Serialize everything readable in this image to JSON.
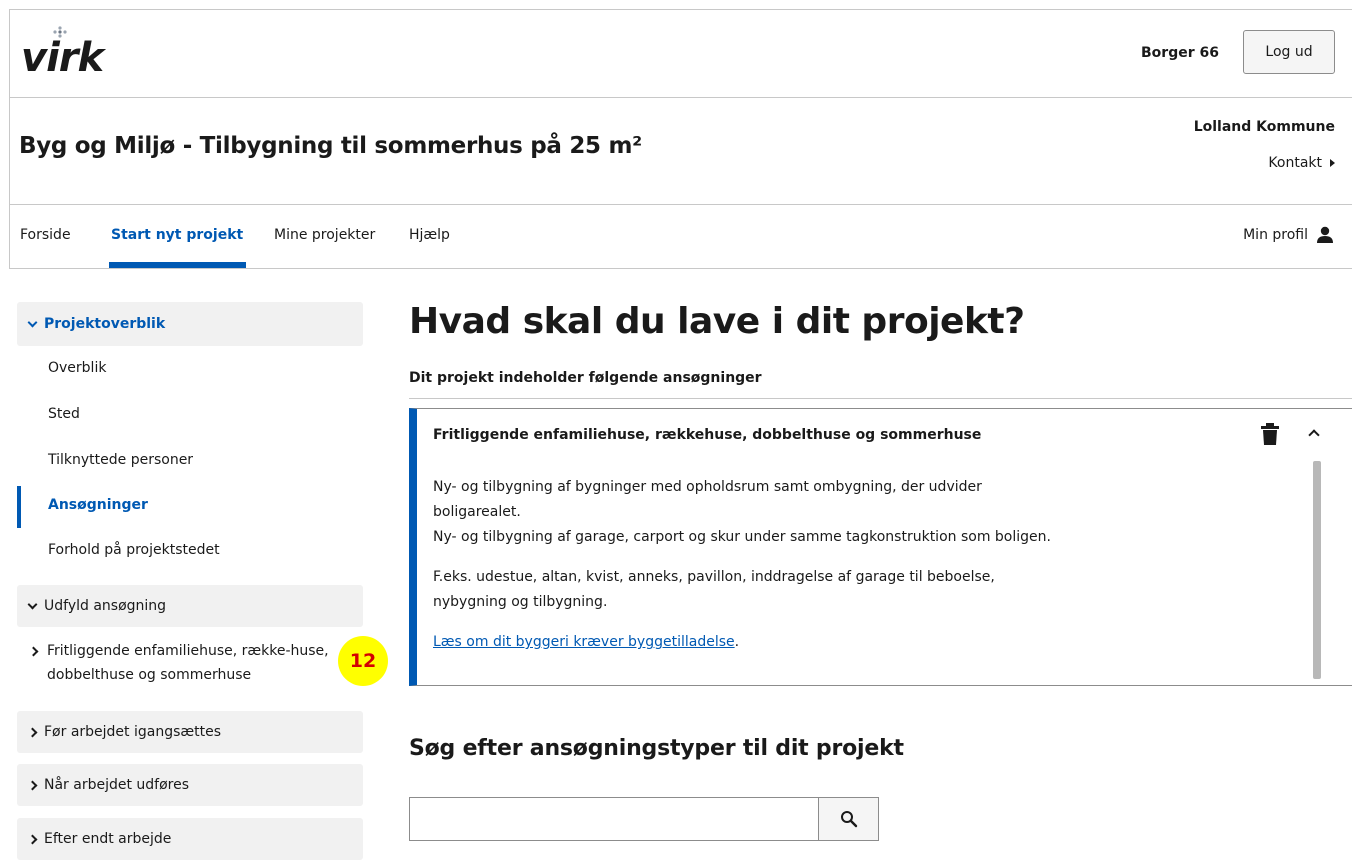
{
  "header": {
    "logo_text": "virk",
    "user_name": "Borger 66",
    "logout_label": "Log ud"
  },
  "titlebar": {
    "title_bold": "Byg og Miljø - ",
    "title_rest": "Tilbygning til sommerhus på 25 m²",
    "municipality": "Lolland Kommune",
    "contact_label": "Kontakt"
  },
  "nav": {
    "items": [
      {
        "label": "Forside"
      },
      {
        "label": "Start nyt projekt"
      },
      {
        "label": "Mine projekter"
      },
      {
        "label": "Hjælp"
      }
    ],
    "profile_label": "Min profil"
  },
  "sidebar": {
    "section_overview": "Projektoverblik",
    "links": [
      {
        "label": "Overblik"
      },
      {
        "label": "Sted"
      },
      {
        "label": "Tilknyttede personer"
      },
      {
        "label": "Ansøgninger"
      },
      {
        "label": "Forhold på projektstedet"
      }
    ],
    "section_fill": "Udfyld ansøgning",
    "application_item": "Fritliggende enfamiliehuse, række-huse, dobbelthuse og sommerhuse",
    "badge": "12",
    "section_before": "Før arbejdet igangsættes",
    "section_during": "Når arbejdet udføres",
    "section_after": "Efter endt arbejde"
  },
  "main": {
    "heading": "Hvad skal du lave i dit projekt?",
    "subheading": "Dit projekt indeholder følgende ansøgninger",
    "card": {
      "title": "Fritliggende enfamiliehuse, rækkehuse, dobbelthuse og sommerhuse",
      "p1_line1": "Ny- og tilbygning af bygninger med opholdsrum samt ombygning, der udvider",
      "p1_line2": "boligarealet.",
      "p1_line3": "Ny- og tilbygning af garage, carport og skur under samme tagkonstruktion som boligen.",
      "p2_line1": "F.eks. udestue, altan, kvist, anneks, pavillon, inddragelse af garage til beboelse,",
      "p2_line2": "nybygning og tilbygning.",
      "link_text": "Læs om dit byggeri kræver byggetilladelse",
      "link_suffix": "."
    },
    "search_heading": "Søg efter ansøgningstyper til dit projekt",
    "search_value": ""
  },
  "colors": {
    "accent": "#0059b3",
    "badge_bg": "#ffff00",
    "badge_text": "#d40000"
  }
}
